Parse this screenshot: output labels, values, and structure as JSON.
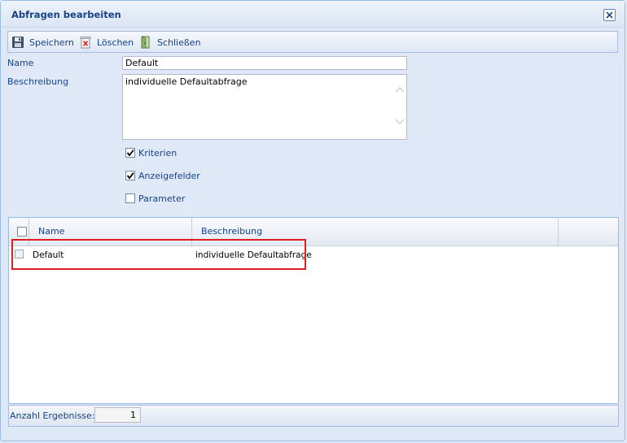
{
  "window": {
    "title": "Abfragen bearbeiten"
  },
  "toolbar": {
    "save_label": "Speichern",
    "delete_label": "Löschen",
    "close_label": "Schließen"
  },
  "form": {
    "name_label": "Name",
    "name_value": "Default",
    "description_label": "Beschreibung",
    "description_value": "individuelle Defaultabfrage",
    "checkboxes": [
      {
        "label": "Kriterien",
        "checked": true
      },
      {
        "label": "Anzeigefelder",
        "checked": true
      },
      {
        "label": "Parameter",
        "checked": false
      }
    ]
  },
  "grid": {
    "columns": [
      "Name",
      "Beschreibung"
    ],
    "rows": [
      {
        "name": "Default",
        "description": "individuelle Defaultabfrage",
        "selected": false
      }
    ]
  },
  "footer": {
    "count_label": "Anzahl Ergebnisse:",
    "count_value": "1"
  },
  "colors": {
    "highlight": "#e02020",
    "accent_text": "#15428b"
  },
  "icons": {
    "save": "floppy-disk-icon",
    "delete": "trash-delete-icon",
    "close": "exit-door-icon",
    "window_close": "close-icon"
  }
}
